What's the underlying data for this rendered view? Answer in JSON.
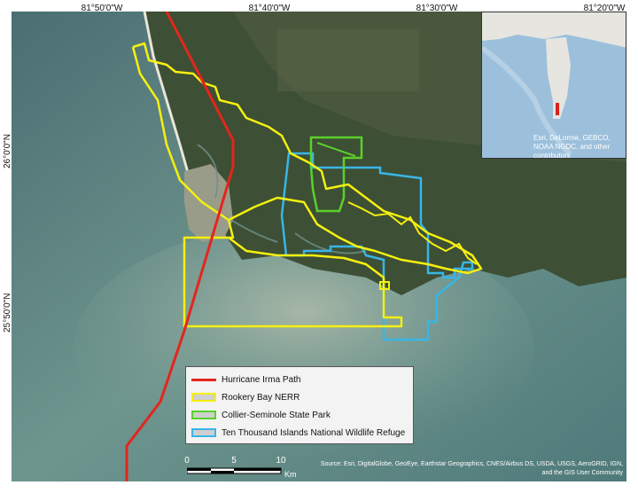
{
  "graticule": {
    "longitudes": [
      "81°50'0\"W",
      "81°40'0\"W",
      "81°30'0\"W",
      "81°20'0\"W"
    ],
    "latitudes": [
      "26°0'0\"N",
      "25°50'0\"N"
    ]
  },
  "legend": {
    "items": [
      {
        "label": "Hurricane Irma Path",
        "color": "#e3261c",
        "kind": "line"
      },
      {
        "label": "Rookery Bay NERR",
        "color": "#f5f00f",
        "kind": "box"
      },
      {
        "label": "Collier-Seminole State Park",
        "color": "#5ad12a",
        "kind": "box"
      },
      {
        "label": "Ten Thousand Islands National Wildlife Refuge",
        "color": "#38b6e6",
        "kind": "box"
      }
    ]
  },
  "scale_bar": {
    "labels": [
      "0",
      "5",
      "10"
    ],
    "unit": "Km"
  },
  "inset": {
    "credit": "Esri, DeLorme, GEBCO, NOAA NGDC, and other contributors"
  },
  "credits": "Source: Esri, DigitalGlobe, GeoEye, Earthstar Geographics, CNES/Airbus DS, USDA, USGS, AeroGRID, IGN, and the GIS User Community"
}
